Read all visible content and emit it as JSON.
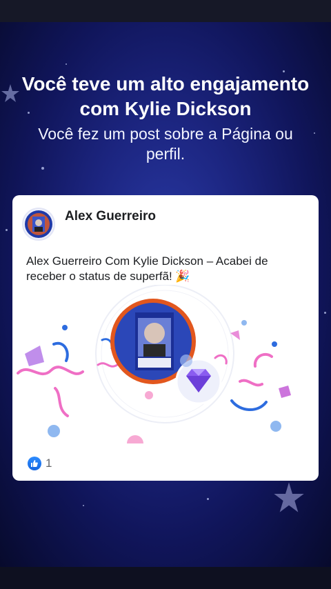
{
  "headline": "Você teve um alto engajamento com Kylie Dickson",
  "subline": "Você fez um post sobre a Página ou perfil.",
  "post": {
    "author": "Alex Guerreiro",
    "text": "Alex Guerreiro Com Kylie Dickson – Acabei de receber o status de superfã! 🎉",
    "reactions": {
      "icon": "like-icon",
      "count": "1"
    }
  },
  "colors": {
    "background": "#1c2580",
    "card": "#ffffff",
    "like": "#1877f2",
    "confetti_pink": "#ef6fc5",
    "confetti_blue": "#2d6cdf",
    "diamond": "#8a5cf0"
  }
}
